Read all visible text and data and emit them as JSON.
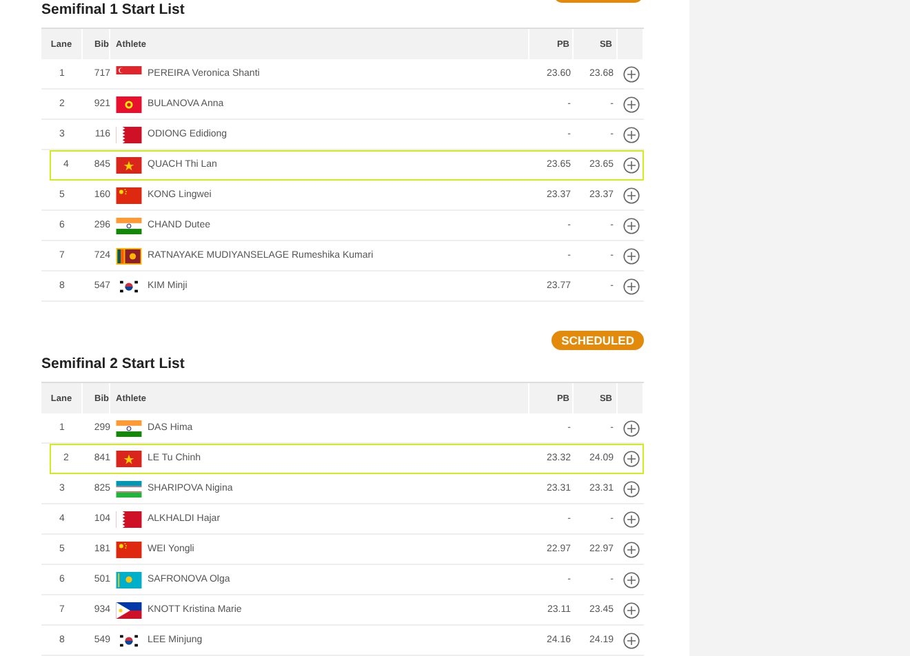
{
  "sections": [
    {
      "title": "Semifinal 1 Start List",
      "badge_cut_off": true,
      "columns": [
        "Lane",
        "Bib",
        "Athlete",
        "PB",
        "SB"
      ],
      "rows": [
        {
          "lane": "1",
          "bib": "717",
          "kind": "sg",
          "athlete": "PEREIRA Veronica Shanti",
          "pb": "23.60",
          "sb": "23.68",
          "highlighted": false
        },
        {
          "lane": "2",
          "bib": "921",
          "kind": "kg",
          "athlete": "BULANOVA Anna",
          "pb": "-",
          "sb": "-",
          "highlighted": false
        },
        {
          "lane": "3",
          "bib": "116",
          "kind": "bh",
          "athlete": "ODIONG Edidiong",
          "pb": "-",
          "sb": "-",
          "highlighted": false
        },
        {
          "lane": "4",
          "bib": "845",
          "kind": "vn",
          "athlete": "QUACH Thi Lan",
          "pb": "23.65",
          "sb": "23.65",
          "highlighted": true
        },
        {
          "lane": "5",
          "bib": "160",
          "kind": "cn",
          "athlete": "KONG Lingwei",
          "pb": "23.37",
          "sb": "23.37",
          "highlighted": false
        },
        {
          "lane": "6",
          "bib": "296",
          "kind": "in",
          "athlete": "CHAND Dutee",
          "pb": "-",
          "sb": "-",
          "highlighted": false
        },
        {
          "lane": "7",
          "bib": "724",
          "kind": "lk",
          "athlete": "RATNAYAKE MUDIYANSELAGE Rumeshika Kumari",
          "pb": "-",
          "sb": "-",
          "highlighted": false
        },
        {
          "lane": "8",
          "bib": "547",
          "kind": "kr",
          "athlete": "KIM Minji",
          "pb": "23.77",
          "sb": "-",
          "highlighted": false
        }
      ]
    },
    {
      "title": "Semifinal 2 Start List",
      "badge": "SCHEDULED",
      "columns": [
        "Lane",
        "Bib",
        "Athlete",
        "PB",
        "SB"
      ],
      "rows": [
        {
          "lane": "1",
          "bib": "299",
          "kind": "in",
          "athlete": "DAS Hima",
          "pb": "-",
          "sb": "-",
          "highlighted": false
        },
        {
          "lane": "2",
          "bib": "841",
          "kind": "vn",
          "athlete": "LE Tu Chinh",
          "pb": "23.32",
          "sb": "24.09",
          "highlighted": true
        },
        {
          "lane": "3",
          "bib": "825",
          "kind": "uz",
          "athlete": "SHARIPOVA Nigina",
          "pb": "23.31",
          "sb": "23.31",
          "highlighted": false
        },
        {
          "lane": "4",
          "bib": "104",
          "kind": "bh",
          "athlete": "ALKHALDI Hajar",
          "pb": "-",
          "sb": "-",
          "highlighted": false
        },
        {
          "lane": "5",
          "bib": "181",
          "kind": "cn",
          "athlete": "WEI Yongli",
          "pb": "22.97",
          "sb": "22.97",
          "highlighted": false
        },
        {
          "lane": "6",
          "bib": "501",
          "kind": "kz",
          "athlete": "SAFRONOVA Olga",
          "pb": "-",
          "sb": "-",
          "highlighted": false
        },
        {
          "lane": "7",
          "bib": "934",
          "kind": "ph",
          "athlete": "KNOTT Kristina Marie",
          "pb": "23.11",
          "sb": "23.45",
          "highlighted": false
        },
        {
          "lane": "8",
          "bib": "549",
          "kind": "kr",
          "athlete": "LEE Minjung",
          "pb": "24.16",
          "sb": "24.19",
          "highlighted": false
        }
      ]
    }
  ]
}
